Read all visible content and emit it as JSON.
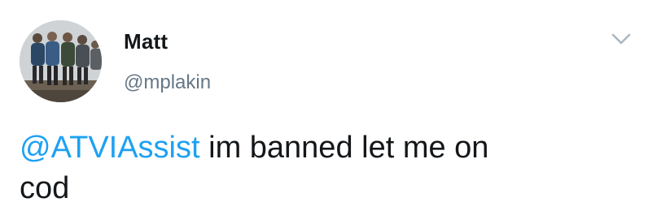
{
  "tweet": {
    "author": {
      "display_name": "Matt",
      "handle": "@mplakin",
      "avatar_icon": "group-photo-avatar"
    },
    "menu_icon": "chevron-down-icon",
    "text": {
      "mention": "@ATVIAssist",
      "body_line1": " im banned let me on",
      "body_line2": "cod"
    },
    "colors": {
      "mention": "#1da1f2",
      "handle": "#657786",
      "text": "#14171a",
      "chevron": "#aab8c2"
    }
  }
}
